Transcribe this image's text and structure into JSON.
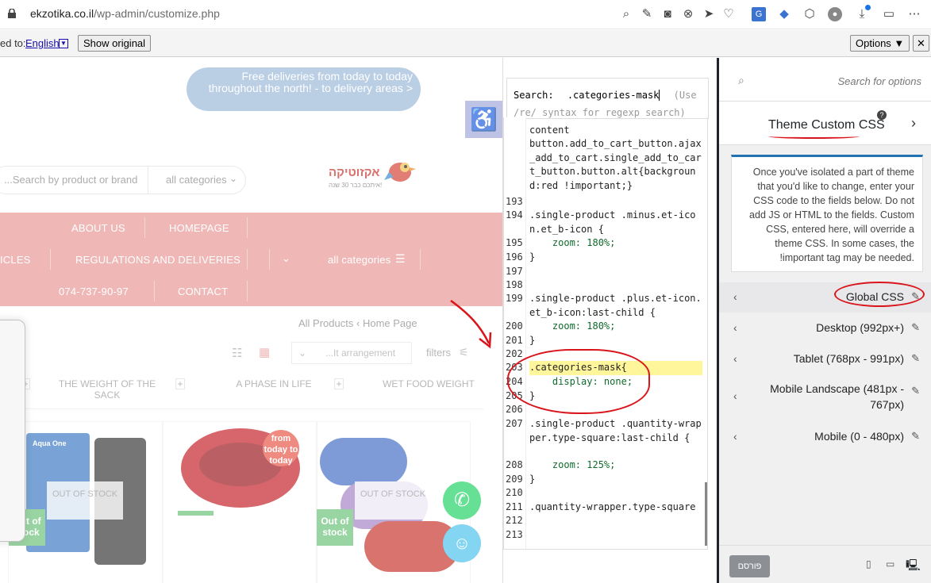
{
  "browser": {
    "url_host": "ekzotika.co.il",
    "url_path": "/wp-admin/customize.php"
  },
  "translate_bar": {
    "label": "ed to:",
    "language": "English",
    "show_original": "Show original",
    "options": "Options ▼",
    "close": "✕"
  },
  "site": {
    "banner": "Free deliveries from today to today throughout the north! - to delivery areas >",
    "logo_text": "אקזוטיקה",
    "logo_sub": "איתכם כבר 30 שנה!",
    "search_placeholder": "...Search by product or brand",
    "search_category": "all categories",
    "menu": {
      "about": "ABOUT US",
      "homepage": "HOMEPAGE",
      "articles": "ICLES",
      "regulations": "REGULATIONS AND DELIVERIES",
      "all_categories": "all categories",
      "phone": "074-737-90-97",
      "contact": "CONTACT"
    },
    "breadcrumb_current": "All Products",
    "breadcrumb_home": "Home Page",
    "sort_placeholder": "...It arrangement",
    "filters": "filters",
    "tabs": [
      "THE WEIGHT OF THE SACK",
      "A PHASE IN LIFE",
      "WET FOOD WEIGHT"
    ],
    "out_of_stock": "OUT OF STOCK",
    "out_of_stock_badge": "Out of stock",
    "promo_badge": "from today to today",
    "brand_box": "Aqua One"
  },
  "code_panel": {
    "search_label": "Search:",
    "search_value": ".categories-mask",
    "search_hint": "(Use /re/ syntax for regexp search)",
    "lines": [
      {
        "n": "",
        "c": "content"
      },
      {
        "n": "",
        "c": "button.add_to_cart_button.ajax_add_to_cart.single_add_to_cart_button.button.alt{background:red !important;}"
      },
      {
        "n": "193",
        "c": ""
      },
      {
        "n": "194",
        "c": ".single-product .minus.et-icon.et_b-icon {"
      },
      {
        "n": "195",
        "c": "    zoom: 180%;"
      },
      {
        "n": "196",
        "c": "}"
      },
      {
        "n": "197",
        "c": ""
      },
      {
        "n": "198",
        "c": ""
      },
      {
        "n": "199",
        "c": ".single-product .plus.et-icon.et_b-icon:last-child {"
      },
      {
        "n": "200",
        "c": "    zoom: 180%;"
      },
      {
        "n": "201",
        "c": "}"
      },
      {
        "n": "202",
        "c": ""
      },
      {
        "n": "203",
        "c": ".categories-mask{"
      },
      {
        "n": "204",
        "c": "    display: none;"
      },
      {
        "n": "205",
        "c": "}"
      },
      {
        "n": "206",
        "c": ""
      },
      {
        "n": "207",
        "c": ".single-product .quantity-wrapper.type-square:last-child {"
      },
      {
        "n": "208",
        "c": "    zoom: 125%;"
      },
      {
        "n": "209",
        "c": "}"
      },
      {
        "n": "210",
        "c": ""
      },
      {
        "n": "211",
        "c": ".quantity-wrapper.type-square"
      },
      {
        "n": "212",
        "c": ""
      },
      {
        "n": "213",
        "c": ""
      }
    ]
  },
  "customizer": {
    "search_placeholder": "Search for options",
    "section_title": "Theme Custom CSS",
    "description": "Once you've isolated a part of theme that you'd like to change, enter your CSS code to the fields below. Do not add JS or HTML to the fields. Custom CSS, entered here, will override a theme CSS. In some cases, the !important tag may be needed.",
    "sections": [
      "Global CSS",
      "Desktop (992px+)",
      "Tablet (768px - 991px)",
      "Mobile Landscape (481px - 767px)",
      "Mobile (0 - 480px)"
    ],
    "publish": "פורסם"
  },
  "colors": {
    "menu_bg": "#e99a98",
    "banner_bg": "#9db9d9",
    "annotation": "#d9151b",
    "admin_accent": "#2271b1"
  }
}
